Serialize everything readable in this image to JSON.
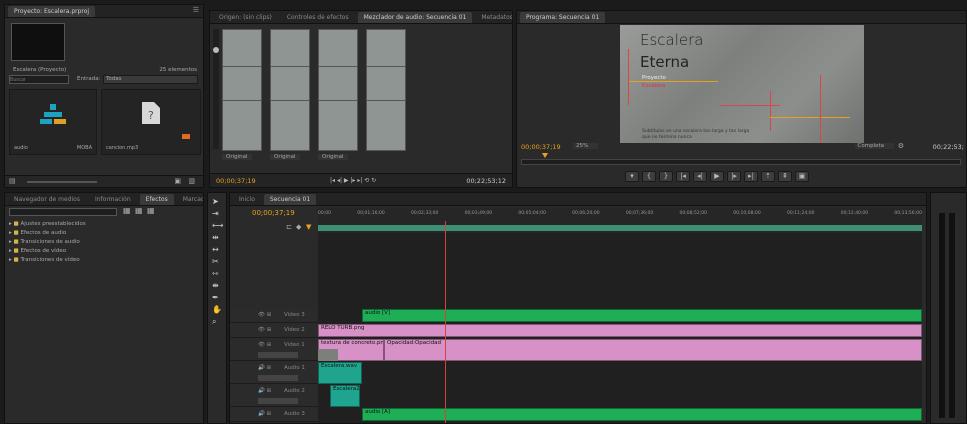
{
  "project": {
    "tab": "Proyecto: Escalera.prproj",
    "thumb_label": "Escalera (Proyecto)",
    "count": "25 elementos",
    "search_placeholder": "Buscar",
    "in_label": "Entrada:",
    "in_value": "Todas",
    "items": [
      {
        "name": "audio",
        "meta": "MOBA"
      },
      {
        "name": "cancion.mp3",
        "meta": ""
      }
    ]
  },
  "source": {
    "tabs": [
      "Origen: (sin clips)",
      "Controles de efectos",
      "Mezclador de audio: Secuencia 01",
      "Metadatos"
    ],
    "channel_labels": [
      "Original",
      "Original",
      "Original"
    ],
    "timecode_left": "00;00;37;19",
    "timecode_right": "00;22;53;12"
  },
  "program": {
    "tab": "Programa: Secuencia 01",
    "title_line1": "Escalera",
    "title_line2": "Eterna",
    "credit1": "Proyecto",
    "credit2": "Escalera",
    "caption1": "Subtítulos en una escalera tan larga y tan larga",
    "caption2": "que no termina nunca",
    "timecode": "00;00;37;19",
    "zoom": "25%",
    "fit": "Completa",
    "timecode_right": "00;22;53;"
  },
  "effects": {
    "tabs": [
      "Navegador de medios",
      "Información",
      "Efectos",
      "Marcadores"
    ],
    "folders": [
      "Ajustes preestablecidos",
      "Efectos de audio",
      "Transiciones de audio",
      "Efectos de vídeo",
      "Transiciones de vídeo"
    ]
  },
  "timeline": {
    "tabs": [
      "Inicio",
      "Secuencia 01"
    ],
    "timecode": "00;00;37;19",
    "ruler": [
      "00;00",
      "00;01;16;00",
      "00;02;33;00",
      "00;03;49;00",
      "00;05;04;00",
      "00;06;20;00",
      "00;07;36;00",
      "00;08;52;00",
      "00;10;08;00",
      "00;11;24;00",
      "00;12;40;00",
      "00;13;56;00"
    ],
    "tracks": [
      {
        "name": "Vídeo 3"
      },
      {
        "name": "Vídeo 2"
      },
      {
        "name": "Vídeo 1"
      },
      {
        "name": "Audio 1"
      },
      {
        "name": "Audio 2"
      },
      {
        "name": "Audio 3"
      }
    ],
    "clips": {
      "v3": "audio [V]",
      "v2": "RELO TURB.png",
      "v1a": "textura de concreto.png",
      "v1b": "Opacidad:Opacidad",
      "a1": "Escalera.wav",
      "a2": "Escalera2",
      "a3": "audio [A]"
    }
  }
}
